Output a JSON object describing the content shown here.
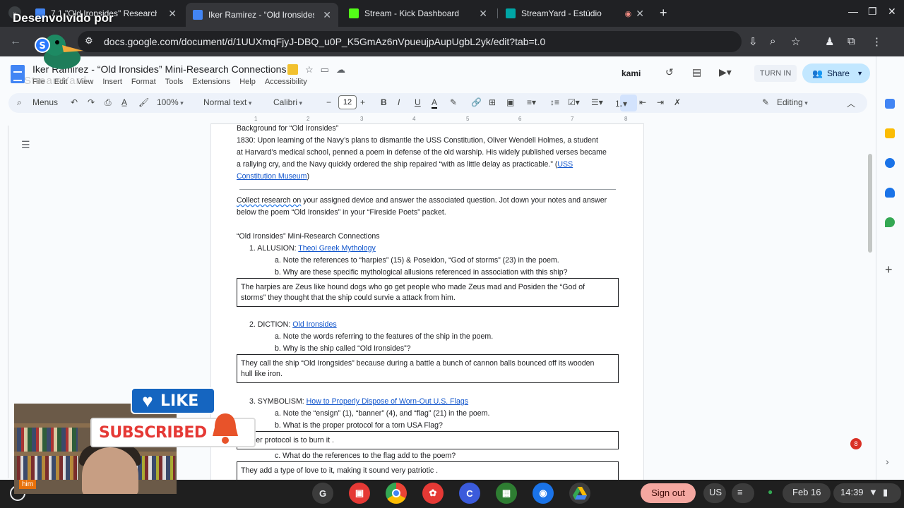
{
  "overlay": {
    "watermark": "Desenvolvido por",
    "streamyard_brand": "StreamYard",
    "like_label": "LIKE",
    "subscribed_label": "SUBSCRIBED",
    "cam_name": "him"
  },
  "browser": {
    "tabs": [
      {
        "title": "7.1 \"Old Ironsides\" Research & ...",
        "close": "✕",
        "color": "#4285f4"
      },
      {
        "title": "Iker Ramirez - “Old Ironsides” M...",
        "close": "✕",
        "color": "#4285f4"
      },
      {
        "title": "Stream - Kick Dashboard",
        "close": "✕",
        "color": "#53fc18"
      },
      {
        "title": "StreamYard - Estúdio",
        "close": "✕",
        "color": "#0aa"
      }
    ],
    "url": "docs.google.com/document/d/1UUXmqFjyJ-DBQ_u0P_K5GmAz6nVpueujpAupUgbL2yk/edit?tab=t.0"
  },
  "docs": {
    "title": "Iker Ramirez - “Old Ironsides” Mini-Research Connections",
    "menus": [
      "File",
      "Edit",
      "View",
      "Insert",
      "Format",
      "Tools",
      "Extensions",
      "Help",
      "Accessibility"
    ],
    "kami": "kami",
    "turn_in": "TURN IN",
    "share": "Share",
    "avatar_initial": "I",
    "toolbar": {
      "menus": "Menus",
      "zoom": "100%",
      "style": "Normal text",
      "font": "Calibri",
      "size": "12",
      "mode": "Editing"
    },
    "ruler": [
      "1",
      "2",
      "3",
      "4",
      "5",
      "6",
      "7",
      "8"
    ]
  },
  "doc": {
    "bg_heading": "Background for “Old Ironsides”",
    "bg_l1": "1830: Upon learning of the Navy’s plans to dismantle the USS Constitution, Oliver Wendell Holmes, a student",
    "bg_l2": "at Harvard’s medical school, penned a poem in defense of the old warship. His widely published verses became",
    "bg_l3": "a rallying cry, and the Navy quickly ordered the ship repaired “with as little delay as practicable.” (",
    "bg_link1": "USS",
    "bg_link2": "Constitution Museum",
    "bg_close": ")",
    "collect_u": "Collect research on",
    "collect_rest": " your assigned device and answer the associated question. Jot down your notes and answer",
    "collect_l2": "below the poem “Old Ironsides” in your “Fireside Poets” packet.",
    "section_title": "“Old Ironsides” Mini-Research Connections",
    "q1": "1.   ALLUSION: ",
    "q1_link": "Theoi Greek Mythology",
    "q1a": "a.   Note the references to “harpies” (15) & Poseidon, “God of storms” (23) in the poem.",
    "q1b": "b.   Why are these specific mythological allusions referenced in association with this ship?",
    "a1_l1": "The harpies are Zeus like hound dogs who go get people who made Zeus mad and Posiden the “God of",
    "a1_l2": "storms” they thought that the ship could survie a attack from him.",
    "q2": "2.   DICTION: ",
    "q2_link": "Old Ironsides",
    "q2a": "a.   Note the words referring to the features of the ship in the poem.",
    "q2b": "b.   Why is the ship called “Old Ironsides”?",
    "a2_l1": "They call the ship “Old Irongsides” because during a battle a bunch of cannon balls bounced off its wooden",
    "a2_l2": "hull like iron.",
    "q3": "3.   SYMBOLISM: ",
    "q3_link": "How to Properly Dispose of Worn-Out U.S. Flags",
    "q3a": "a.   Note the “ensign” (1), “banner” (4), and “flag” (21) in the poem.",
    "q3b": "b.   What is the proper protocol for a torn USA Flag?",
    "a3": "proper protocol is to burn it .",
    "q3c": "c.   What do the references to the flag add to the poem?",
    "a4": "They add a type of love to it, making it sound very patriotic ."
  },
  "notif_count": "8",
  "shelf": {
    "sign_out": "Sign out",
    "lang": "US",
    "date": "Feb 16",
    "time": "14:39"
  }
}
